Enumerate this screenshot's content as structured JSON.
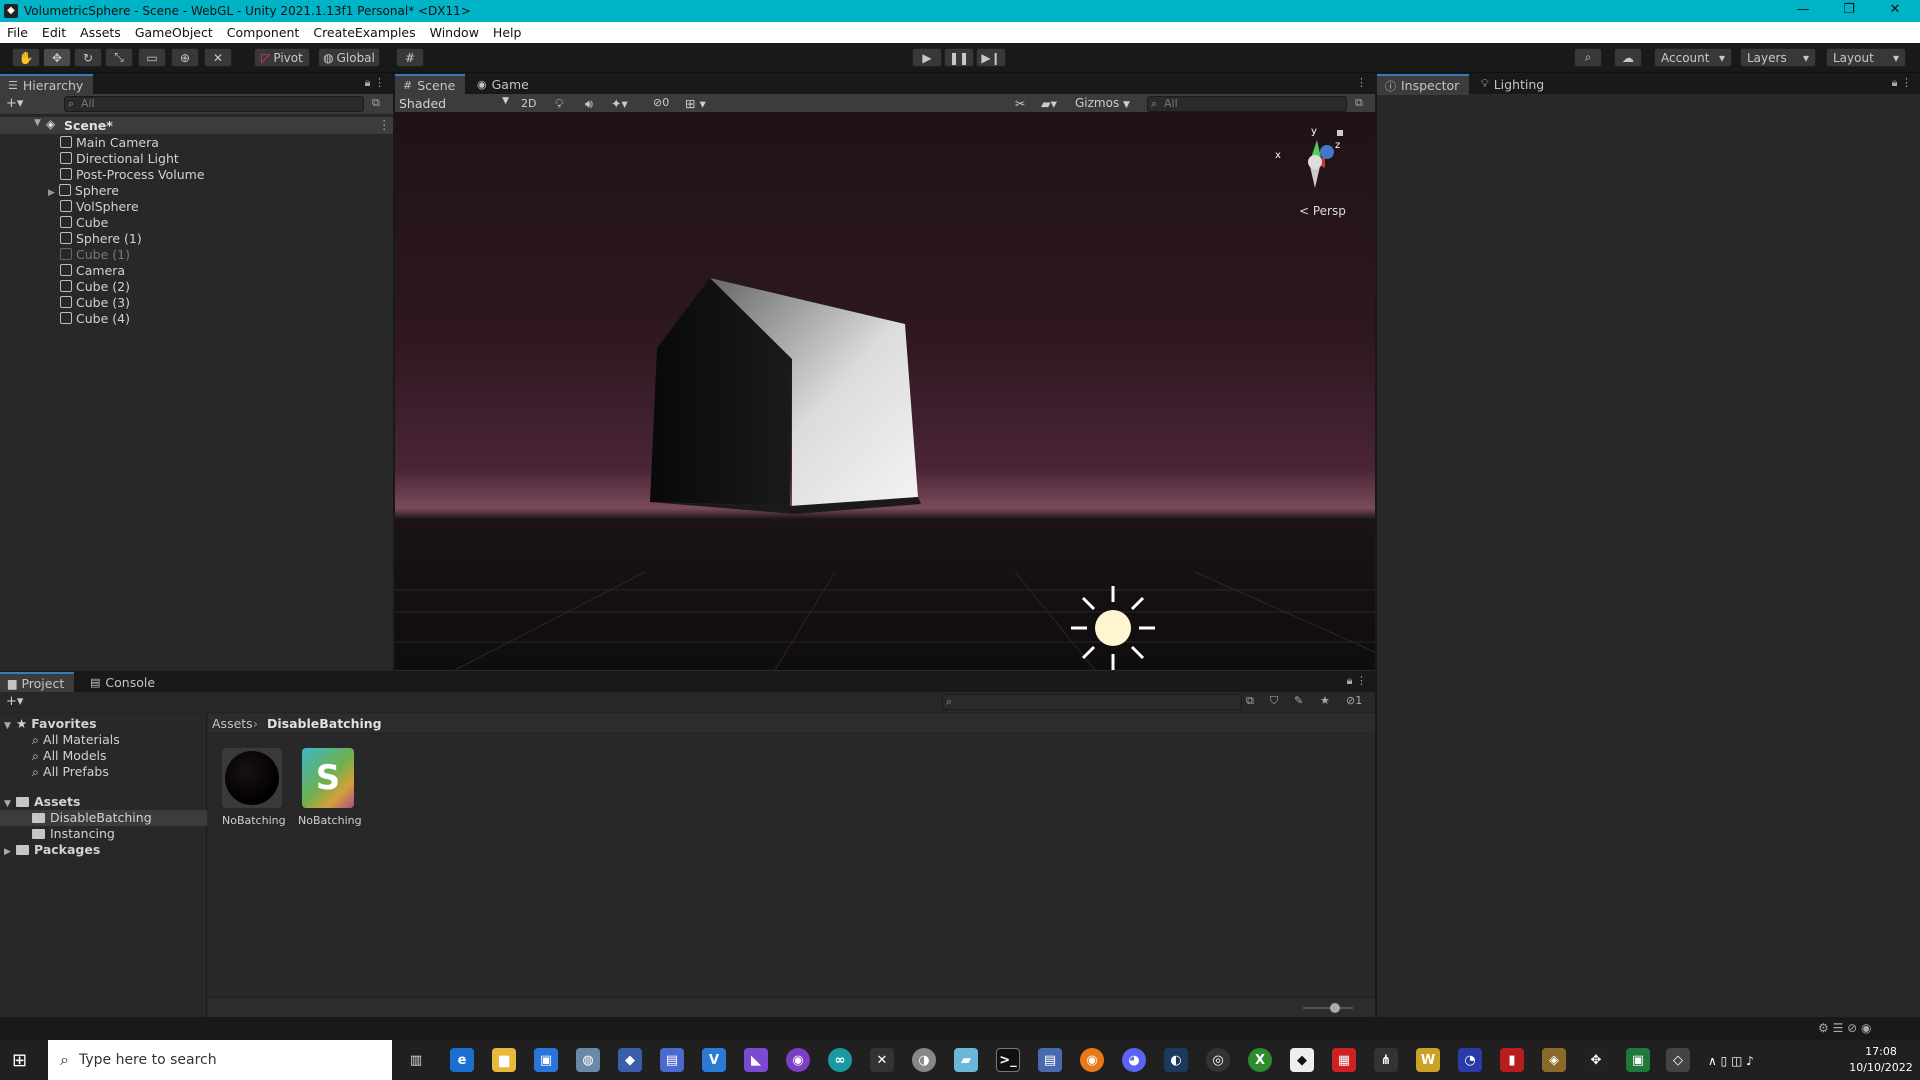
{
  "window": {
    "title": "VolumetricSphere - Scene - WebGL - Unity 2021.1.13f1 Personal* <DX11>"
  },
  "menu": [
    "File",
    "Edit",
    "Assets",
    "GameObject",
    "Component",
    "CreateExamples",
    "Window",
    "Help"
  ],
  "toolbar": {
    "pivot": "Pivot",
    "global": "Global",
    "account": "Account",
    "layers": "Layers",
    "layout": "Layout"
  },
  "hierarchy": {
    "tab": "Hierarchy",
    "search_placeholder": "All",
    "scene": "Scene*",
    "items": [
      {
        "label": "Main Camera"
      },
      {
        "label": "Directional Light"
      },
      {
        "label": "Post-Process Volume"
      },
      {
        "label": "Sphere"
      },
      {
        "label": "VolSphere"
      },
      {
        "label": "Cube"
      },
      {
        "label": "Sphere (1)"
      },
      {
        "label": "Cube (1)"
      },
      {
        "label": "Camera"
      },
      {
        "label": "Cube (2)"
      },
      {
        "label": "Cube (3)"
      },
      {
        "label": "Cube (4)"
      }
    ]
  },
  "scene": {
    "tabs": [
      "Scene",
      "Game"
    ],
    "shading": "Shaded",
    "mode2d": "2D",
    "hidden_count": "0",
    "gizmos": "Gizmos",
    "search_placeholder": "All",
    "persp": "< Persp",
    "axis_x": "x",
    "axis_y": "y",
    "axis_z": "z"
  },
  "inspector": {
    "tabs": [
      "Inspector",
      "Lighting"
    ]
  },
  "project": {
    "tabs": [
      "Project",
      "Console"
    ],
    "favorites": {
      "label": "Favorites",
      "items": [
        "All Materials",
        "All Models",
        "All Prefabs"
      ]
    },
    "assets": {
      "label": "Assets",
      "items": [
        "DisableBatching",
        "Instancing"
      ]
    },
    "packages": "Packages",
    "breadcrumb": [
      "Assets",
      "DisableBatching"
    ],
    "files": [
      {
        "name": "NoBatching",
        "type": "material"
      },
      {
        "name": "NoBatching",
        "type": "shader",
        "glyph": "S"
      }
    ],
    "count_badge": "1"
  },
  "taskbar": {
    "search_placeholder": "Type here to search",
    "time": "17:08",
    "date": "10/10/2022"
  },
  "colors": {
    "titlebar": "#00b4c8",
    "selection_accent": "#3a79bb",
    "panel": "#282828"
  }
}
